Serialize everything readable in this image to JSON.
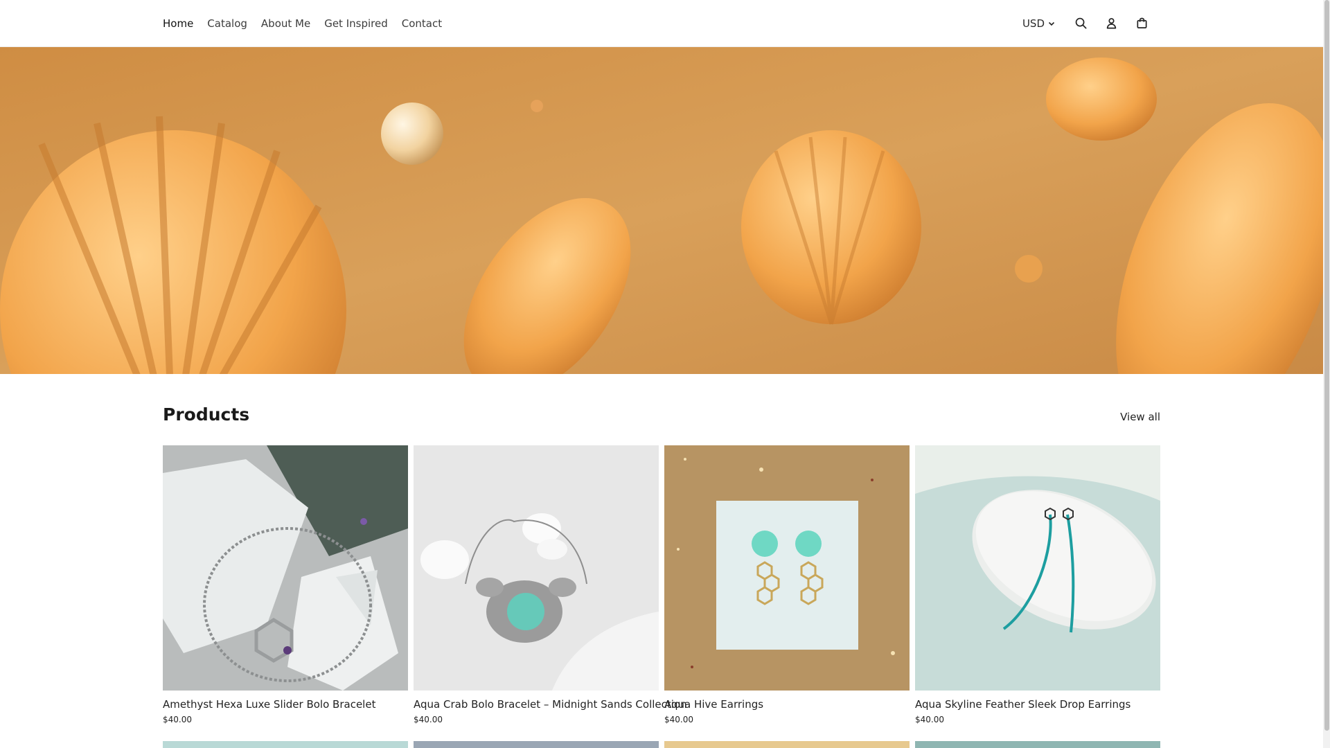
{
  "header": {
    "nav": [
      "Home",
      "Catalog",
      "About Me",
      "Get Inspired",
      "Contact"
    ],
    "currency": "USD",
    "icons": [
      "search-icon",
      "account-icon",
      "cart-icon"
    ]
  },
  "products": {
    "title": "Products",
    "view_all": "View all",
    "items": [
      {
        "title": "Amethyst Hexa Luxe Slider Bolo Bracelet",
        "price": "$40.00"
      },
      {
        "title": "Aqua Crab Bolo Bracelet – Midnight Sands Collection",
        "price": "$40.00"
      },
      {
        "title": "Aqua Hive Earrings",
        "price": "$40.00"
      },
      {
        "title": "Aqua Skyline Feather Sleek Drop Earrings",
        "price": "$40.00"
      }
    ]
  },
  "colors": {
    "sand": "#d79a4e",
    "shell": "#f0a247",
    "aqua": "#5fd1c4",
    "border": "#ececec"
  }
}
